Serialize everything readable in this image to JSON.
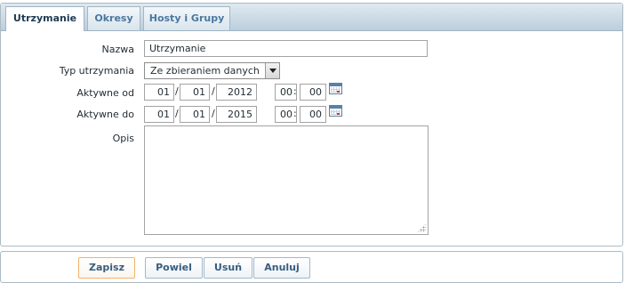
{
  "tabs": [
    {
      "label": "Utrzymanie",
      "active": true
    },
    {
      "label": "Okresy",
      "active": false
    },
    {
      "label": "Hosty i Grupy",
      "active": false
    }
  ],
  "form": {
    "name": {
      "label": "Nazwa",
      "value": "Utrzymanie"
    },
    "type": {
      "label": "Typ utrzymania",
      "value": "Ze zbieraniem danych"
    },
    "active_since": {
      "label": "Aktywne od",
      "day": "01",
      "month": "01",
      "year": "2012",
      "hour": "00",
      "minute": "00"
    },
    "active_till": {
      "label": "Aktywne do",
      "day": "01",
      "month": "01",
      "year": "2015",
      "hour": "00",
      "minute": "00"
    },
    "description": {
      "label": "Opis",
      "value": ""
    },
    "date_sep": "/",
    "time_sep": ":"
  },
  "icons": {
    "calendar": "calendar-icon",
    "dropdown": "chevron-down-icon",
    "resize": "resize-grip-icon"
  },
  "buttons": {
    "save": "Zapisz",
    "clone": "Powiel",
    "delete": "Usuń",
    "cancel": "Anuluj"
  },
  "colors": {
    "tab_text": "#4a78a0",
    "primary_border": "#f2b36a",
    "tabbar": "#bccedc"
  }
}
